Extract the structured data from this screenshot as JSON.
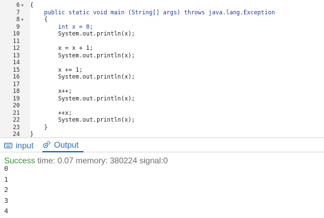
{
  "editor": {
    "line_numbers": [
      "6",
      "7",
      "8",
      "9",
      "10",
      "11",
      "12",
      "13",
      "14",
      "15",
      "16",
      "17",
      "18",
      "19",
      "20",
      "21",
      "22",
      "23",
      "24"
    ],
    "code_lines": [
      "{",
      "    public static void main (String[] args) throws java.lang.Exception",
      "    {",
      "        int x = 0;",
      "        System.out.println(x);",
      "",
      "        x = x + 1;",
      "        System.out.println(x);",
      "",
      "        x += 1;",
      "        System.out.println(x);",
      "",
      "        x++;",
      "        System.out.println(x);",
      "",
      "        ++x;",
      "        System.out.println(x);",
      "    }",
      "}"
    ]
  },
  "tabs": {
    "input_label": "input",
    "output_label": "Output",
    "input_icon": "keyboard-icon",
    "output_icon": "gears-icon"
  },
  "output": {
    "success_label": "Success",
    "details": "time: 0.07 memory: 380224 signal:0",
    "lines": [
      "0",
      "1",
      "2",
      "3",
      "4"
    ]
  },
  "colors": {
    "tab_blue": "#2e6db4",
    "success_green": "#3c8a3c",
    "gutter_bg": "#f3f3f3",
    "keyword_blue": "#1f3f99"
  }
}
